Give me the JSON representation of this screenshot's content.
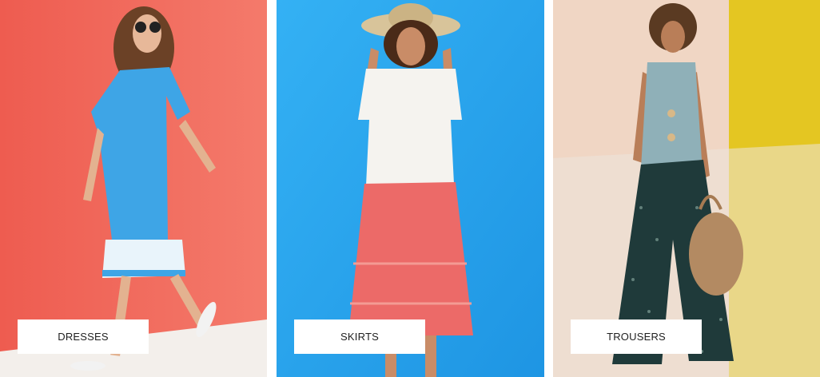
{
  "categories": [
    {
      "label": "DRESSES",
      "background": "#f2675a",
      "floor": "#f2efec",
      "photo": "woman in blue floral dress"
    },
    {
      "label": "SKIRTS",
      "background": "#2ea6f0",
      "floor": "#2ea6f0",
      "photo": "woman in white top and coral tiered skirt"
    },
    {
      "label": "TROUSERS",
      "background": "#e8cfb9",
      "accent": "#e6c927",
      "floor": "#ede6dd",
      "photo": "woman in linen waistcoat and printed wide trousers"
    }
  ]
}
